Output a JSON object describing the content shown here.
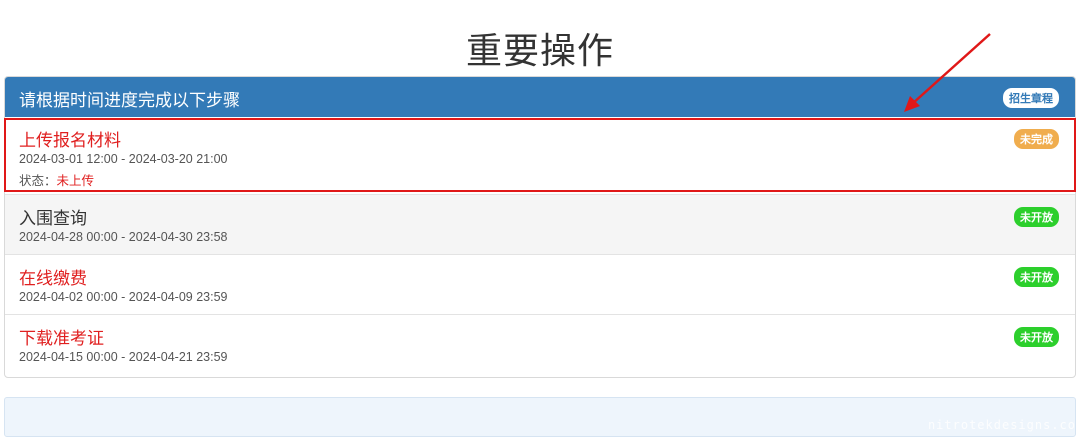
{
  "page_title": "重要操作",
  "panel": {
    "header_text": "请根据时间进度完成以下步骤",
    "header_badge": "招生章程"
  },
  "steps": [
    {
      "title": "上传报名材料",
      "time": "2024-03-01 12:00 - 2024-03-20 21:00",
      "status_label": "状态：",
      "status_value": "未上传",
      "badge": "未完成"
    },
    {
      "title": "入围查询",
      "time": "2024-04-28 00:00 - 2024-04-30 23:58",
      "badge": "未开放"
    },
    {
      "title": "在线缴费",
      "time": "2024-04-02 00:00 - 2024-04-09 23:59",
      "badge": "未开放"
    },
    {
      "title": "下载准考证",
      "time": "2024-04-15 00:00 - 2024-04-21 23:59",
      "badge": "未开放"
    }
  ],
  "watermark": "nitrotekdesigns.co",
  "colors": {
    "header_blue": "#337ab7",
    "red_text": "#e02020",
    "badge_orange": "#f0ad4e",
    "badge_green": "#2ccf2c",
    "annotation_red": "#e01818"
  }
}
